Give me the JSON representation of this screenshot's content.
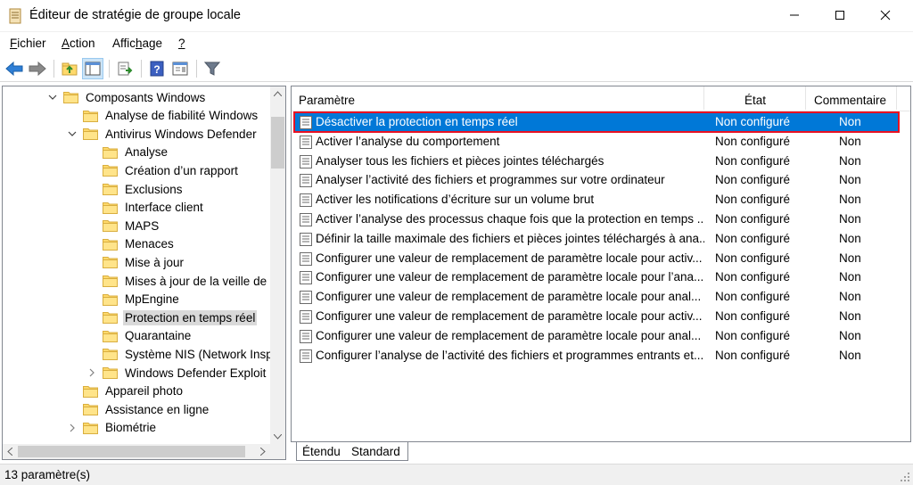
{
  "window": {
    "title": "Éditeur de stratégie de groupe locale"
  },
  "menu": [
    {
      "label_u": "F",
      "label_rest": "ichier"
    },
    {
      "label_u": "A",
      "label_rest": "ction"
    },
    {
      "label_pre": "Affic",
      "label_u": "h",
      "label_rest": "age"
    },
    {
      "label_u": "?",
      "label_rest": ""
    }
  ],
  "toolbar": {
    "icons": [
      "back-arrow-icon",
      "forward-arrow-icon",
      "up-folder-icon",
      "show-hide-tree-icon",
      "export-list-icon",
      "help-icon",
      "properties-icon",
      "filter-icon"
    ]
  },
  "tree": {
    "items": [
      {
        "label": "Composants Windows",
        "expander": "expanded"
      },
      {
        "label": "Analyse de fiabilité Windows",
        "expander": "none"
      },
      {
        "label": "Antivirus Windows Defender",
        "expander": "expanded"
      },
      {
        "label": "Analyse",
        "expander": "none"
      },
      {
        "label": "Création d’un rapport",
        "expander": "none"
      },
      {
        "label": "Exclusions",
        "expander": "none"
      },
      {
        "label": "Interface client",
        "expander": "none"
      },
      {
        "label": "MAPS",
        "expander": "none"
      },
      {
        "label": "Menaces",
        "expander": "none"
      },
      {
        "label": "Mise à jour",
        "expander": "none"
      },
      {
        "label": "Mises à jour de la veille de",
        "expander": "none"
      },
      {
        "label": "MpEngine",
        "expander": "none"
      },
      {
        "label": "Protection en temps réel",
        "expander": "none",
        "selected": true
      },
      {
        "label": "Quarantaine",
        "expander": "none"
      },
      {
        "label": "Système NIS (Network Inspe",
        "expander": "none"
      },
      {
        "label": "Windows Defender Exploit",
        "expander": "collapsed"
      },
      {
        "label": "Appareil photo",
        "expander": "none"
      },
      {
        "label": "Assistance en ligne",
        "expander": "none"
      },
      {
        "label": "Biométrie",
        "expander": "collapsed"
      }
    ]
  },
  "list": {
    "headers": {
      "setting": "Paramètre",
      "state": "État",
      "comment": "Commentaire"
    },
    "rows": [
      {
        "name": "Désactiver la protection en temps réel",
        "state": "Non configuré",
        "comment": "Non",
        "selected": true
      },
      {
        "name": "Activer l’analyse du comportement",
        "state": "Non configuré",
        "comment": "Non"
      },
      {
        "name": "Analyser tous les fichiers et pièces jointes téléchargés",
        "state": "Non configuré",
        "comment": "Non"
      },
      {
        "name": "Analyser l’activité des fichiers et programmes sur votre ordinateur",
        "state": "Non configuré",
        "comment": "Non"
      },
      {
        "name": "Activer les notifications d’écriture sur un volume brut",
        "state": "Non configuré",
        "comment": "Non"
      },
      {
        "name": "Activer l’analyse des processus chaque fois que la protection en temps ...",
        "state": "Non configuré",
        "comment": "Non"
      },
      {
        "name": "Définir la taille maximale des fichiers et pièces jointes téléchargés à ana...",
        "state": "Non configuré",
        "comment": "Non"
      },
      {
        "name": "Configurer une valeur de remplacement de paramètre locale pour activ...",
        "state": "Non configuré",
        "comment": "Non"
      },
      {
        "name": "Configurer une valeur de remplacement de paramètre locale pour l’ana...",
        "state": "Non configuré",
        "comment": "Non"
      },
      {
        "name": "Configurer une valeur de remplacement de paramètre locale pour anal...",
        "state": "Non configuré",
        "comment": "Non"
      },
      {
        "name": "Configurer une valeur de remplacement de paramètre locale pour activ...",
        "state": "Non configuré",
        "comment": "Non"
      },
      {
        "name": "Configurer une valeur de remplacement de paramètre locale pour anal...",
        "state": "Non configuré",
        "comment": "Non"
      },
      {
        "name": "Configurer l’analyse de l’activité des fichiers et programmes entrants et...",
        "state": "Non configuré",
        "comment": "Non"
      }
    ]
  },
  "tabs": [
    {
      "label": "Étendu"
    },
    {
      "label": "Standard",
      "active": true
    }
  ],
  "status": {
    "text": "13 paramètre(s)"
  },
  "colors": {
    "selection": "#0078d7",
    "highlight_border": "#e81123",
    "folder": "#ffd96b"
  }
}
